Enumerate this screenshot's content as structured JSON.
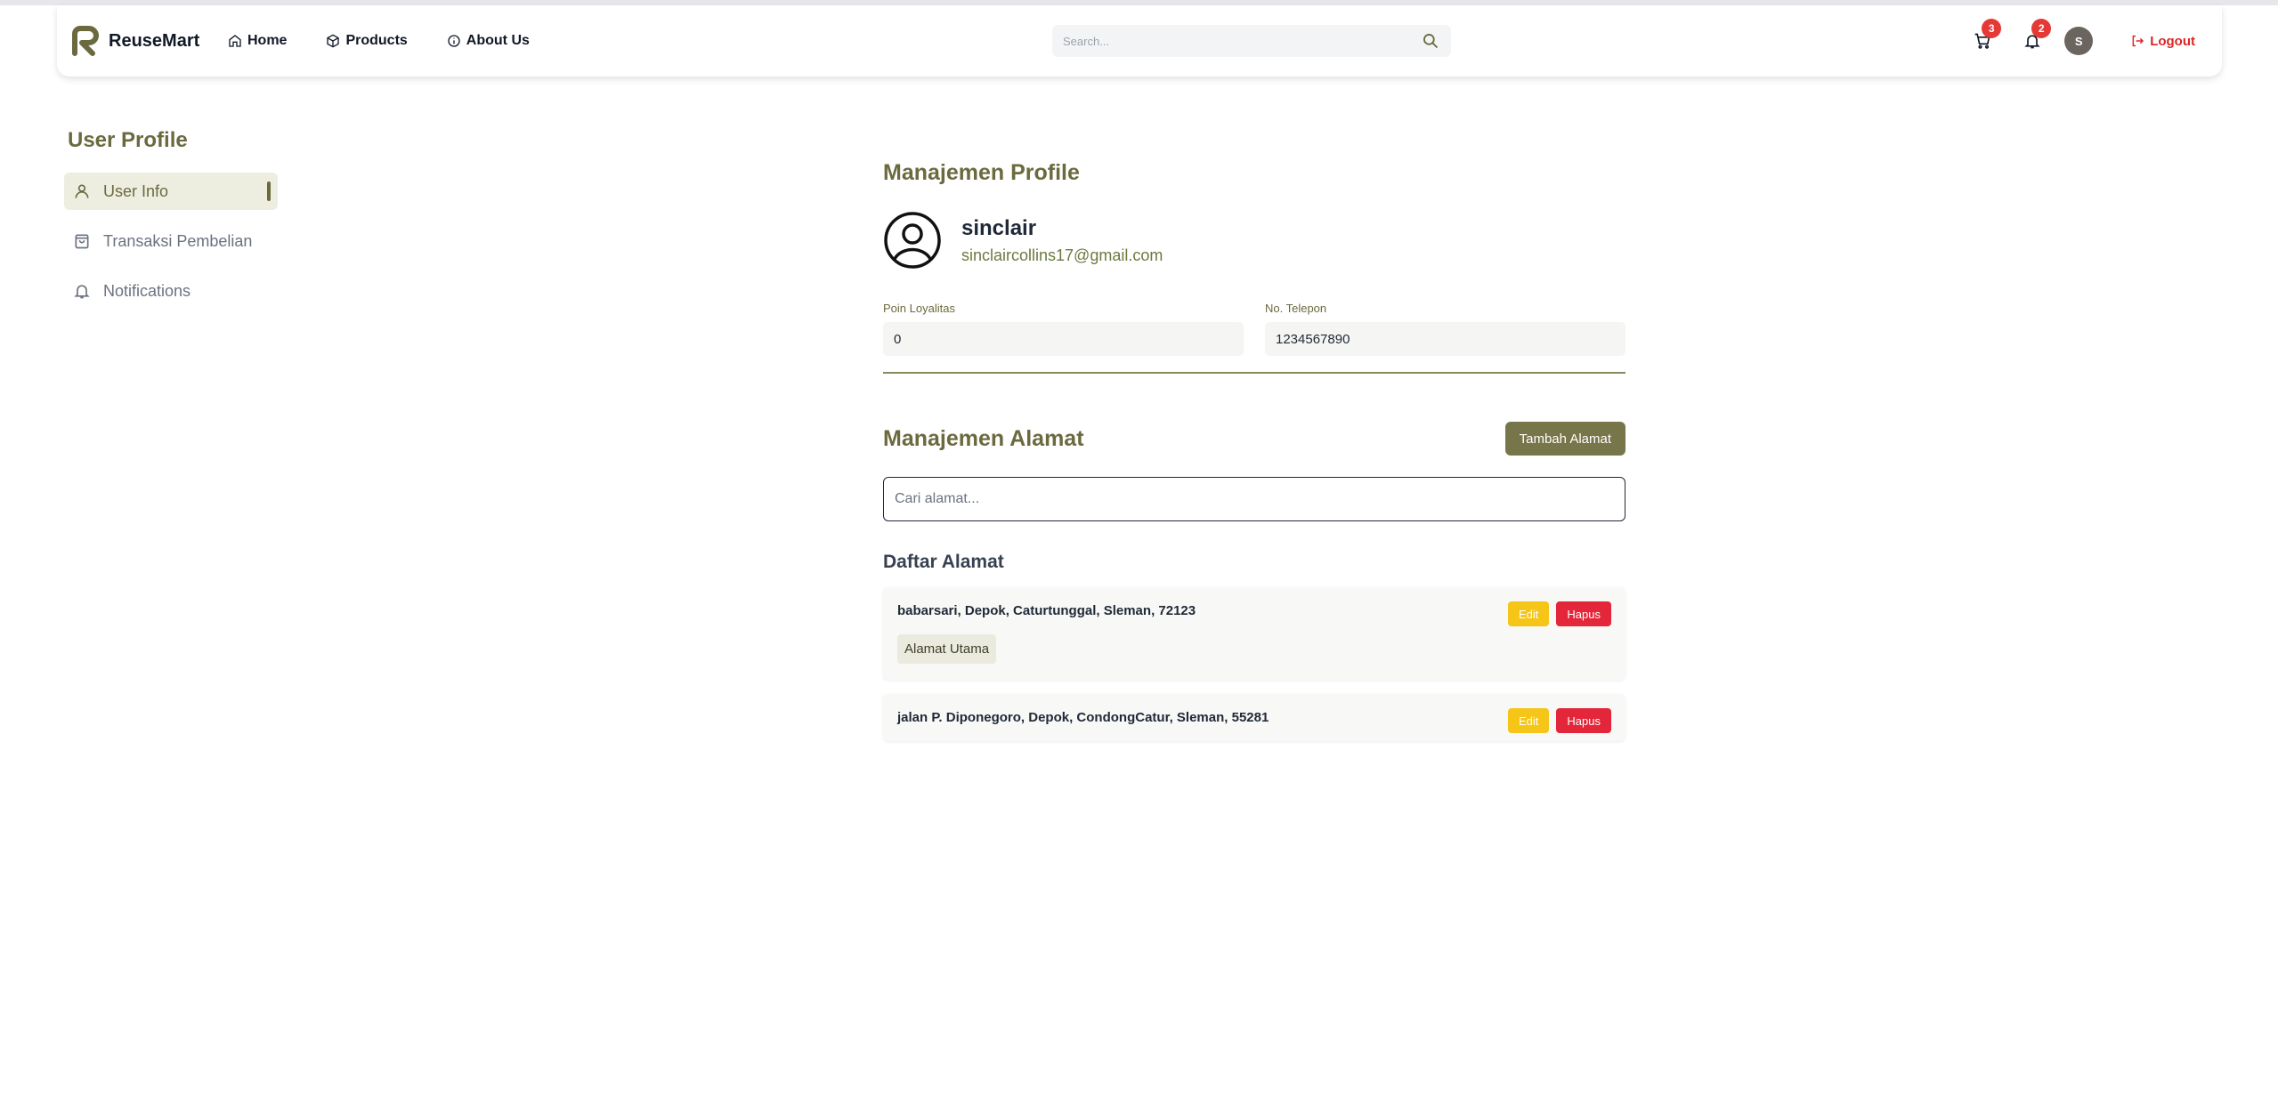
{
  "navbar": {
    "brand": "ReuseMart",
    "links": [
      {
        "label": "Home",
        "icon": "home-icon"
      },
      {
        "label": "Products",
        "icon": "box-icon"
      },
      {
        "label": "About Us",
        "icon": "info-icon"
      }
    ],
    "search_placeholder": "Search...",
    "cart_count": "3",
    "notif_count": "2",
    "avatar_initial": "S",
    "logout_label": "Logout"
  },
  "sidebar": {
    "title": "User Profile",
    "items": [
      {
        "label": "User Info",
        "icon": "user-icon",
        "active": true
      },
      {
        "label": "Transaksi Pembelian",
        "icon": "shopping-bag-icon",
        "active": false
      },
      {
        "label": "Notifications",
        "icon": "bell-icon",
        "active": false
      }
    ]
  },
  "profile": {
    "section_title": "Manajemen Profile",
    "name": "sinclair",
    "email": "sinclaircollins17@gmail.com",
    "fields": [
      {
        "label": "Poin Loyalitas",
        "value": "0"
      },
      {
        "label": "No. Telepon",
        "value": "1234567890"
      }
    ]
  },
  "address": {
    "section_title": "Manajemen Alamat",
    "add_button": "Tambah Alamat",
    "search_placeholder": "Cari alamat...",
    "list_title": "Daftar Alamat",
    "edit_label": "Edit",
    "delete_label": "Hapus",
    "items": [
      {
        "text": "babarsari, Depok, Caturtunggal, Sleman, 72123",
        "badge": "Alamat Utama"
      },
      {
        "text": "jalan P. Diponegoro, Depok, CondongCatur, Sleman, 55281"
      }
    ]
  },
  "colors": {
    "accent": "#6b6a3f",
    "button": "#77764a",
    "edit": "#f5c518",
    "delete": "#e3263a",
    "badge": "#e53935"
  }
}
